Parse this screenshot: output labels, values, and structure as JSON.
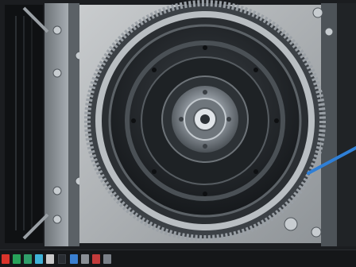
{
  "viewer": {
    "image_subject": "machine-flywheel-photo"
  },
  "taskbar": {
    "window_label": "",
    "icons": [
      {
        "name": "app-icon-1",
        "color": "#d9342b"
      },
      {
        "name": "app-icon-2",
        "color": "#27a35a"
      },
      {
        "name": "app-icon-3",
        "color": "#2f9e6a"
      },
      {
        "name": "app-icon-4",
        "color": "#3fb3d8"
      },
      {
        "name": "app-icon-5",
        "color": "#c9c9c9"
      },
      {
        "name": "app-icon-6",
        "color": "#3a7fd0"
      },
      {
        "name": "app-icon-7",
        "color": "#8a8f95"
      },
      {
        "name": "app-icon-8",
        "color": "#c23b3b"
      },
      {
        "name": "app-icon-9",
        "color": "#7a8088"
      }
    ]
  }
}
